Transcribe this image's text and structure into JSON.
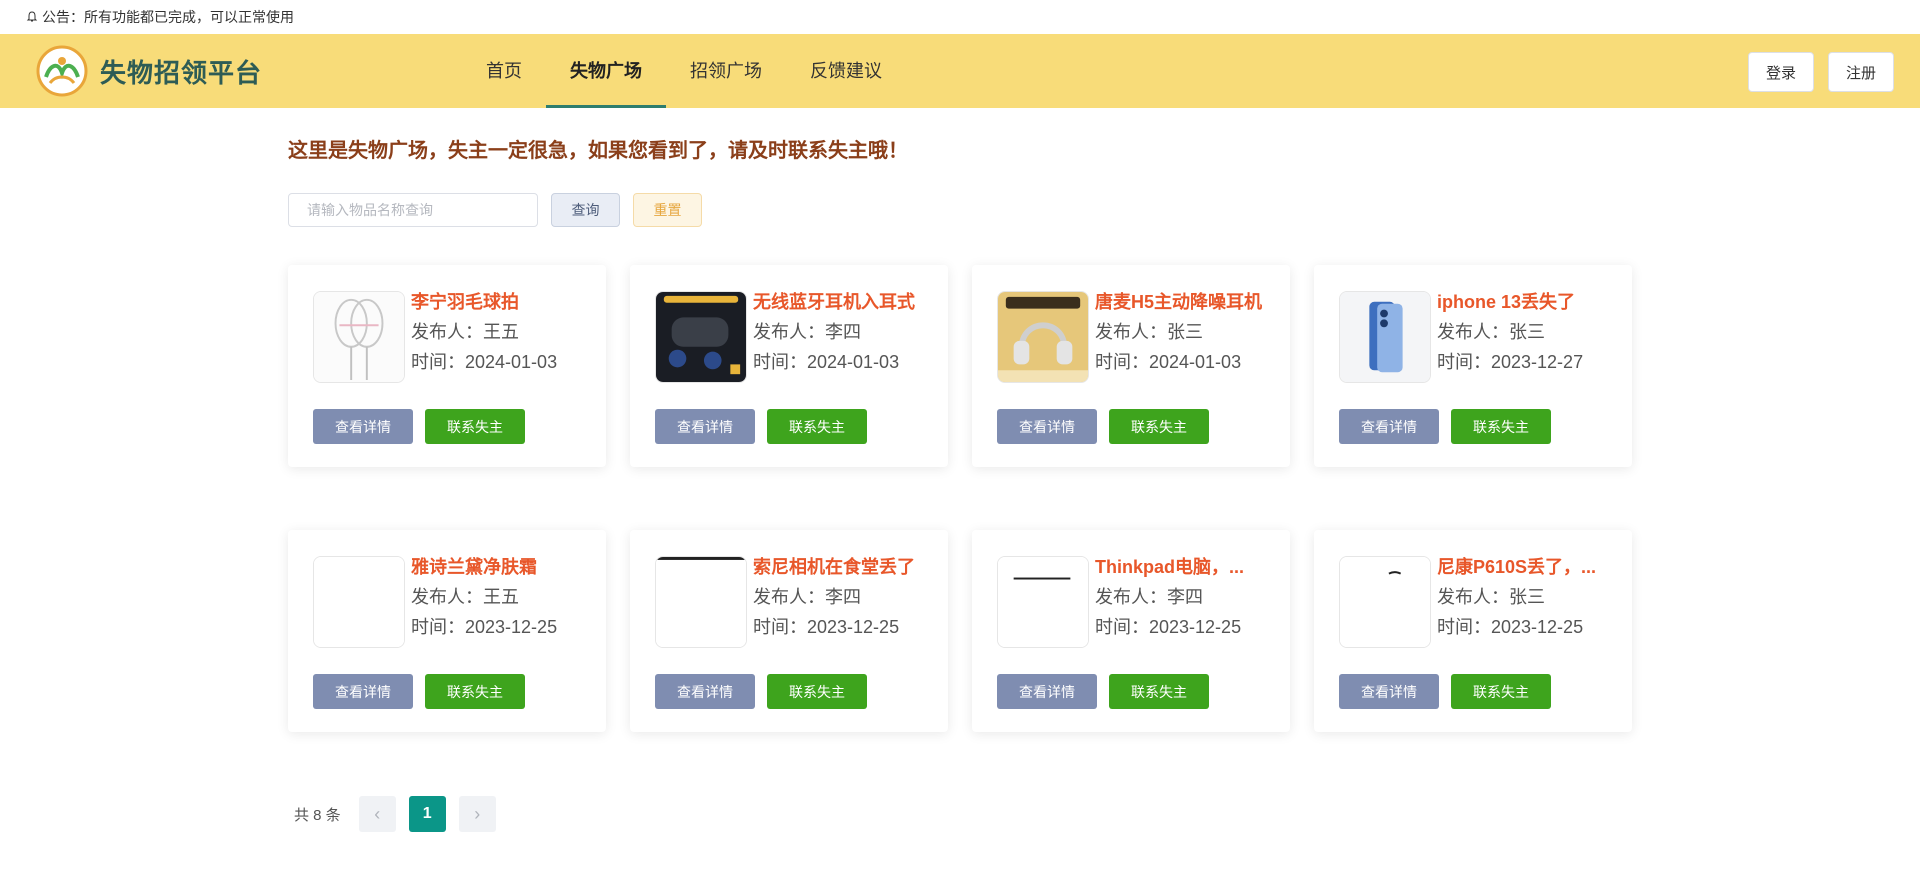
{
  "notice": {
    "text": "公告：所有功能都已完成，可以正常使用",
    "icon": "bell-icon"
  },
  "header": {
    "title": "失物招领平台",
    "nav": [
      {
        "label": "首页",
        "active": false
      },
      {
        "label": "失物广场",
        "active": true
      },
      {
        "label": "招领广场",
        "active": false
      },
      {
        "label": "反馈建议",
        "active": false
      }
    ],
    "login": "登录",
    "register": "注册",
    "colors": {
      "bar": "#f8dc79",
      "active_underline": "#2e7d6e"
    }
  },
  "main": {
    "headline": "这里是失物广场，失主一定很急，如果您看到了，请及时联系失主哦！",
    "search": {
      "placeholder": "请输入物品名称查询",
      "value": "",
      "query": "查询",
      "reset": "重置"
    },
    "items": [
      {
        "title": "李宁羽毛球拍",
        "publisher": "发布人：王五",
        "time": "时间：2024-01-03",
        "detail": "查看详情",
        "contact": "联系失主"
      },
      {
        "title": "无线蓝牙耳机入耳式",
        "publisher": "发布人：李四",
        "time": "时间：2024-01-03",
        "detail": "查看详情",
        "contact": "联系失主"
      },
      {
        "title": "唐麦H5主动降噪耳机",
        "publisher": "发布人：张三",
        "time": "时间：2024-01-03",
        "detail": "查看详情",
        "contact": "联系失主"
      },
      {
        "title": "iphone 13丢失了",
        "publisher": "发布人：张三",
        "time": "时间：2023-12-27",
        "detail": "查看详情",
        "contact": "联系失主"
      },
      {
        "title": "雅诗兰黛净肤霜",
        "publisher": "发布人：王五",
        "time": "时间：2023-12-25",
        "detail": "查看详情",
        "contact": "联系失主"
      },
      {
        "title": "索尼相机在食堂丢了",
        "publisher": "发布人：李四",
        "time": "时间：2023-12-25",
        "detail": "查看详情",
        "contact": "联系失主"
      },
      {
        "title": "Thinkpad电脑，...",
        "publisher": "发布人：李四",
        "time": "时间：2023-12-25",
        "detail": "查看详情",
        "contact": "联系失主"
      },
      {
        "title": "尼康P610S丢了，...",
        "publisher": "发布人：张三",
        "time": "时间：2023-12-25",
        "detail": "查看详情",
        "contact": "联系失主"
      }
    ],
    "pager": {
      "total": "共 8 条",
      "current": "1"
    }
  }
}
